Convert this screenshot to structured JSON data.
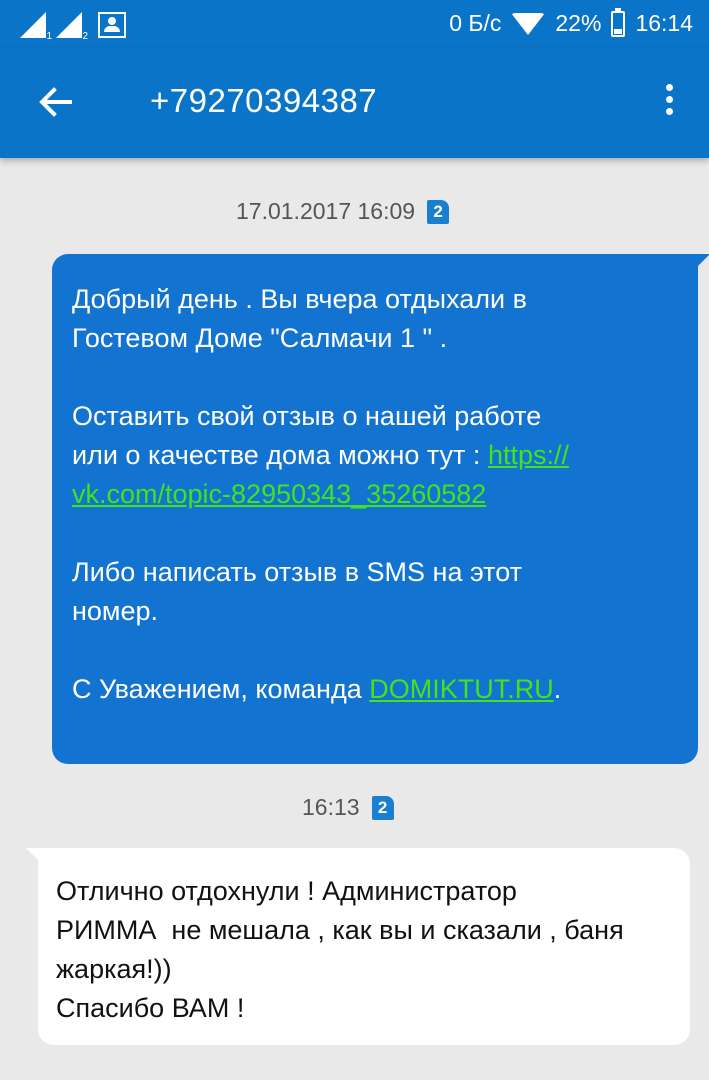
{
  "status_bar": {
    "sim1_label": "1",
    "sim2_label": "2",
    "data_speed": "0 Б/с",
    "battery": "22%",
    "battery_level": 0.22,
    "time": "16:14",
    "icons": [
      "signal-icon",
      "signal-icon",
      "photo-notification-icon",
      "wifi-icon",
      "battery-icon"
    ]
  },
  "app_bar": {
    "title": "+79270394387",
    "back_icon": "arrow-back-icon",
    "menu_icon": "more-vert-icon"
  },
  "messages": [
    {
      "direction": "incoming",
      "timestamp": "17.01.2017 16:09",
      "sim": "2",
      "line1": "Добрый день . Вы вчера отдыхали в",
      "line2": "Гостевом Доме \"Салмачи 1 \" .",
      "line3": "Оставить свой отзыв о нашей работе",
      "line4": "или о качестве дома можно тут : ",
      "link1_part1": "https://",
      "link1_part2": "vk.com/topic-82950343_35260582",
      "line5": "Либо написать отзыв в SMS на этот",
      "line6": "номер.",
      "line7_prefix": "С Уважением, команда ",
      "link2": "DOMIKTUT.RU",
      "line7_suffix": "."
    },
    {
      "direction": "outgoing",
      "timestamp": "16:13",
      "sim": "2",
      "line1": "Отлично отдохнули ! Администратор",
      "line2": "РИММА  не мешала , как вы и сказали , баня",
      "line3": "жаркая!))",
      "line4": "Спасибо ВАМ !"
    }
  ],
  "colors": {
    "bar": "#0a74c9",
    "incoming_bubble": "#1273d1",
    "outgoing_bubble": "#ffffff",
    "link": "#41e41a",
    "background": "#e9e9e9"
  }
}
